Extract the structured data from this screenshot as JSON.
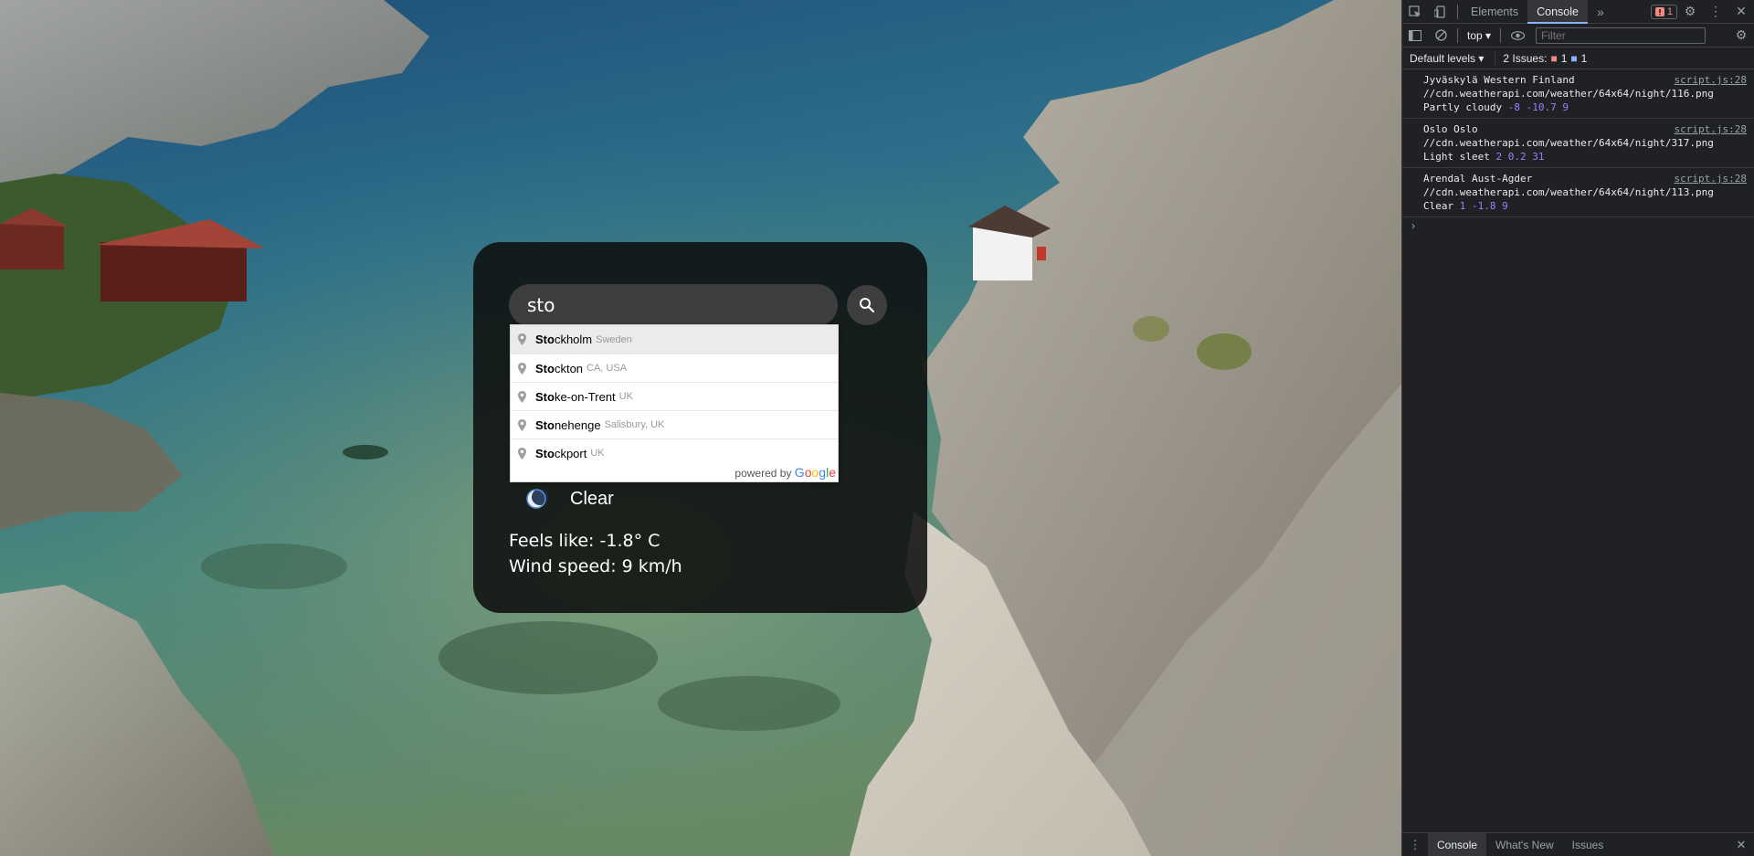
{
  "weather_card": {
    "search_value": "sto",
    "search_icon": "magnifier-icon",
    "condition_icon": "moon-icon",
    "condition": "Clear",
    "feels_like": "Feels like: -1.8° C",
    "wind_speed": "Wind speed: 9 km/h"
  },
  "autocomplete": {
    "items": [
      {
        "match": "Sto",
        "rest": "ckholm",
        "secondary": "Sweden"
      },
      {
        "match": "Sto",
        "rest": "ckton",
        "secondary": "CA, USA"
      },
      {
        "match": "Sto",
        "rest": "ke-on-Trent",
        "secondary": "UK"
      },
      {
        "match": "Sto",
        "rest": "nehenge",
        "secondary": "Salisbury, UK"
      },
      {
        "match": "Sto",
        "rest": "ckport",
        "secondary": "UK"
      }
    ],
    "powered_by": "powered by",
    "brand": "Google",
    "brand_colors": [
      "#4285F4",
      "#EA4335",
      "#FBBC05",
      "#4285F4",
      "#34A853",
      "#EA4335"
    ]
  },
  "devtools": {
    "tabs": [
      "Elements",
      "Console"
    ],
    "active_tab": "Console",
    "more_icon": "chevron-double-right-icon",
    "error_count": "1",
    "context": "top",
    "filter_placeholder": "Filter",
    "levels": "Default levels",
    "issues_label": "2 Issues:",
    "issues_error_count": "1",
    "issues_info_count": "1",
    "messages": [
      {
        "line1": "Jyväskylä Western Finland",
        "line2": "//cdn.weatherapi.com/weather/64x64/night/116.png",
        "line3_text": "Partly cloudy",
        "line3_nums": "-8 -10.7 9",
        "source": "script.js:28"
      },
      {
        "line1": "Oslo Oslo",
        "line2": "//cdn.weatherapi.com/weather/64x64/night/317.png",
        "line3_text": "Light sleet",
        "line3_nums": "2 0.2 31",
        "source": "script.js:28"
      },
      {
        "line1": "Arendal Aust-Agder",
        "line2": "//cdn.weatherapi.com/weather/64x64/night/113.png",
        "line3_text": "Clear",
        "line3_nums": "1 -1.8 9",
        "source": "script.js:28"
      }
    ],
    "prompt": "›",
    "drawer_tabs": [
      "Console",
      "What's New",
      "Issues"
    ],
    "drawer_active": "Console",
    "accent": "#8ab4f8",
    "error_color": "#f28b82"
  }
}
